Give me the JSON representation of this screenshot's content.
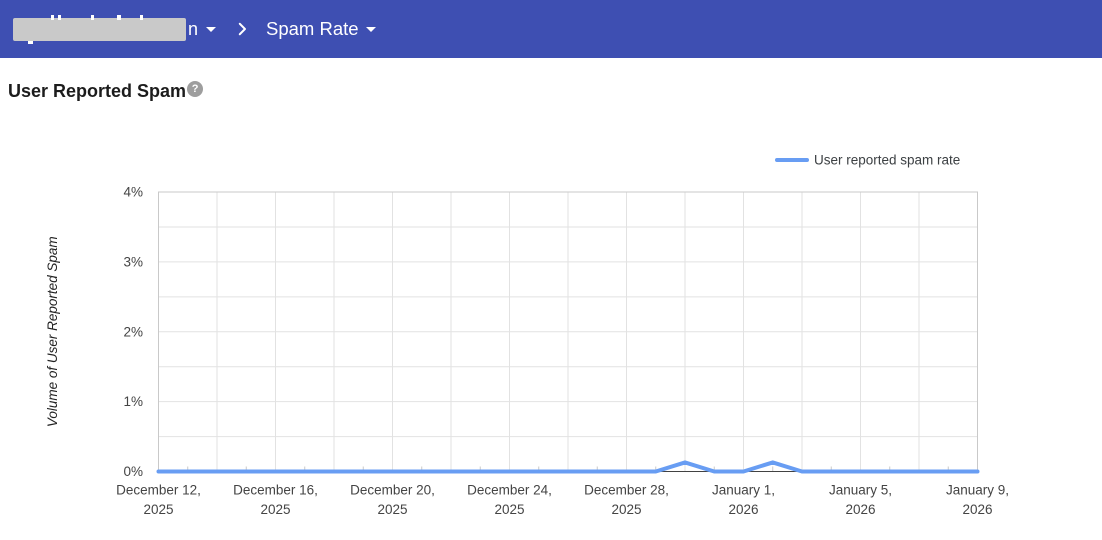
{
  "header": {
    "bg_color": "#3e4fb2",
    "domain_visible_suffix": "n",
    "breadcrumb_current": "Spam Rate"
  },
  "icons": {
    "help_glyph": "?"
  },
  "page": {
    "title": "User Reported Spam"
  },
  "chart_data": {
    "type": "line",
    "title": "User Reported Spam",
    "ylabel": "Volume of User Reported Spam",
    "ylim": [
      0,
      4
    ],
    "y_tick_labels": [
      "0%",
      "1%",
      "2%",
      "3%",
      "4%"
    ],
    "grid": true,
    "legend_position": "top-right",
    "categories": [
      "2025-12-12",
      "2025-12-13",
      "2025-12-14",
      "2025-12-15",
      "2025-12-16",
      "2025-12-17",
      "2025-12-18",
      "2025-12-19",
      "2025-12-20",
      "2025-12-21",
      "2025-12-22",
      "2025-12-23",
      "2025-12-24",
      "2025-12-25",
      "2025-12-26",
      "2025-12-27",
      "2025-12-28",
      "2025-12-29",
      "2025-12-30",
      "2025-12-31",
      "2026-01-01",
      "2026-01-02",
      "2026-01-03",
      "2026-01-04",
      "2026-01-05",
      "2026-01-06",
      "2026-01-07",
      "2026-01-08",
      "2026-01-09"
    ],
    "series": [
      {
        "name": "User reported spam rate",
        "color": "#689df3",
        "values": [
          0,
          0,
          0,
          0,
          0,
          0,
          0,
          0,
          0,
          0,
          0,
          0,
          0,
          0,
          0,
          0,
          0,
          0,
          0.13,
          0,
          0,
          0.13,
          0,
          0,
          0,
          0,
          0,
          0,
          0
        ]
      }
    ],
    "x_axis_ticks": [
      {
        "index": 0,
        "line1": "December 12,",
        "line2": "2025"
      },
      {
        "index": 4,
        "line1": "December 16,",
        "line2": "2025"
      },
      {
        "index": 8,
        "line1": "December 20,",
        "line2": "2025"
      },
      {
        "index": 12,
        "line1": "December 24,",
        "line2": "2025"
      },
      {
        "index": 16,
        "line1": "December 28,",
        "line2": "2025"
      },
      {
        "index": 20,
        "line1": "January 1,",
        "line2": "2026"
      },
      {
        "index": 24,
        "line1": "January 5,",
        "line2": "2026"
      },
      {
        "index": 28,
        "line1": "January 9,",
        "line2": "2026"
      }
    ],
    "minor_gridline_every_days": 2,
    "colors": {
      "gridline": "#e2e2e2",
      "plot_border": "#c9c9c9",
      "baseline": "#424242",
      "tick_label": "#444444",
      "legend_text": "#3c4043"
    }
  }
}
